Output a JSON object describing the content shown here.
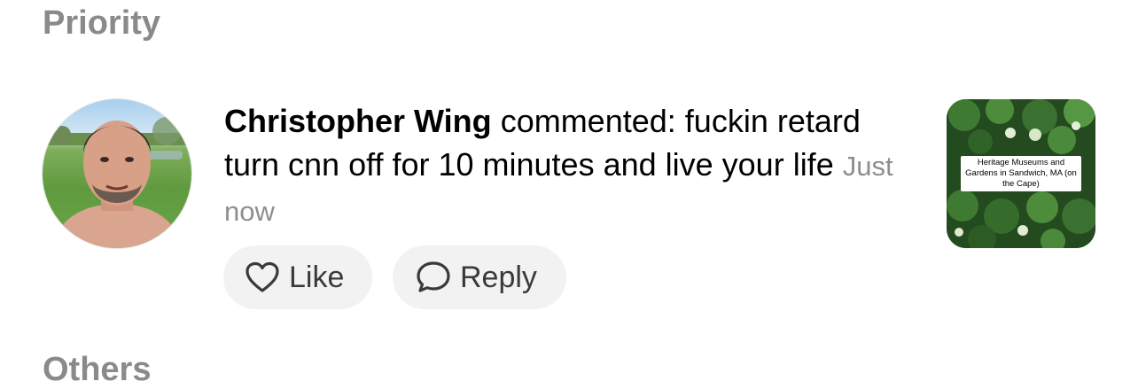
{
  "sections": {
    "priority": "Priority",
    "others": "Others"
  },
  "notification": {
    "author": "Christopher Wing",
    "action": "commented:",
    "comment": "fuckin retard turn cnn off for 10 minutes and live your life",
    "timestamp": "Just now",
    "avatar_icon": "user-photo",
    "thumbnail_caption": "Heritage Museums and Gardens in Sandwich, MA (on the Cape)"
  },
  "actions": {
    "like_label": "Like",
    "like_icon": "heart-outline-icon",
    "reply_label": "Reply",
    "reply_icon": "speech-bubble-icon"
  },
  "colors": {
    "section_title": "#8a8a8a",
    "timestamp": "#8e8e93",
    "button_bg": "#f2f2f2",
    "button_text": "#3a3a3c"
  }
}
